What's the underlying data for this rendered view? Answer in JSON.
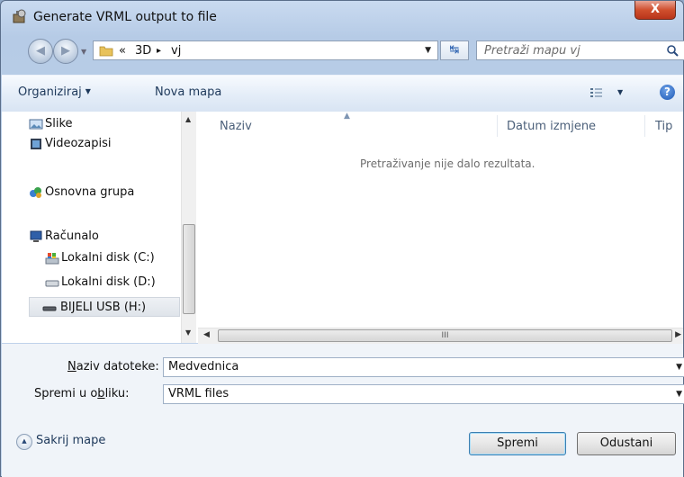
{
  "window": {
    "title": "Generate VRML output to file",
    "close_label": "X"
  },
  "address_bar": {
    "prefix": "«",
    "crumbs": [
      "3D",
      "vj"
    ],
    "separator": "▸"
  },
  "search": {
    "placeholder": "Pretraži mapu vj"
  },
  "toolbar": {
    "organize_label": "Organiziraj",
    "new_folder_label": "Nova mapa",
    "help_label": "?"
  },
  "nav_pane": {
    "items": [
      {
        "label": "Slike",
        "icon": "pictures-icon"
      },
      {
        "label": "Videozapisi",
        "icon": "videos-icon"
      },
      {
        "label": "Osnovna grupa",
        "icon": "homegroup-icon"
      },
      {
        "label": "Računalo",
        "icon": "computer-icon"
      },
      {
        "label": "Lokalni disk (C:)",
        "icon": "system-drive-icon"
      },
      {
        "label": "Lokalni disk (D:)",
        "icon": "drive-icon"
      },
      {
        "label": "BIJELI USB (H:)",
        "icon": "usb-drive-icon",
        "selected": true
      }
    ]
  },
  "file_list": {
    "columns": [
      "Naziv",
      "Datum izmjene",
      "Tip"
    ],
    "empty_message": "Pretraživanje nije dalo rezultata."
  },
  "scrollbar": {
    "thumb_glyph": "III"
  },
  "form": {
    "filename_label_pre": "",
    "filename_label_u": "N",
    "filename_label_post": "aziv datoteke:",
    "filename_value": "Medvednica",
    "type_label_pre": "Spremi u o",
    "type_label_u": "b",
    "type_label_post": "liku:",
    "type_value": "VRML files"
  },
  "footer": {
    "hide_folders_label": "Sakrij mape",
    "save_label": "Spremi",
    "cancel_label": "Odustani"
  },
  "colors": {
    "accent": "#1e395b",
    "title_close": "#c9452a",
    "selection": "#dfe4ea"
  }
}
